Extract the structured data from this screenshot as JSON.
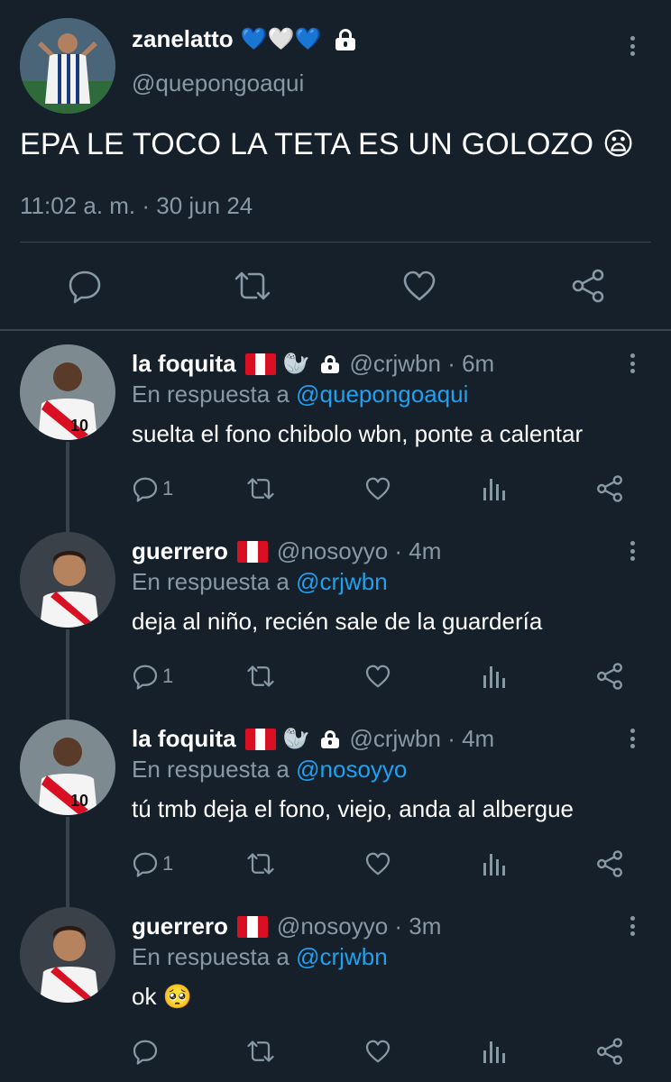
{
  "main_tweet": {
    "display_name": "zanelatto",
    "badges": "💙🤍💙",
    "handle": "@quepongoaqui",
    "text": "EPA LE TOCO LA TETA ES UN GOLOZO",
    "emoji": "😦",
    "timestamp": "11:02 a. m. · 30 jun 24",
    "icons": [
      "reply-icon",
      "retweet-icon",
      "like-icon",
      "share-icon"
    ]
  },
  "replies": [
    {
      "display_name": "la foquita",
      "flag": "peru",
      "extra_emoji": "🦭",
      "handle": "@crjwbn",
      "time": "6m",
      "in_reply_prefix": "En respuesta a",
      "mention": "@quepongoaqui",
      "text": "suelta el fono chibolo wbn, ponte a calentar",
      "reply_count": "1"
    },
    {
      "display_name": "guerrero",
      "flag": "peru",
      "handle": "@nosoyyo",
      "time": "4m",
      "in_reply_prefix": "En respuesta a",
      "mention": "@crjwbn",
      "text": "deja al niño, recién sale de la guardería",
      "reply_count": "1"
    },
    {
      "display_name": "la foquita",
      "flag": "peru",
      "extra_emoji": "🦭",
      "handle": "@crjwbn",
      "time": "4m",
      "in_reply_prefix": "En respuesta a",
      "mention": "@nosoyyo",
      "text": "tú tmb deja el fono, viejo, anda al albergue",
      "reply_count": "1"
    },
    {
      "display_name": "guerrero",
      "flag": "peru",
      "handle": "@nosoyyo",
      "time": "3m",
      "in_reply_prefix": "En respuesta a",
      "mention": "@crjwbn",
      "text": "ok",
      "emoji": "🥺",
      "reply_count": ""
    }
  ],
  "colors": {
    "background": "#15202b",
    "secondary_text": "#8899a6",
    "mention": "#1da1f2",
    "divider": "#38444d",
    "peru_red": "#d91023"
  }
}
